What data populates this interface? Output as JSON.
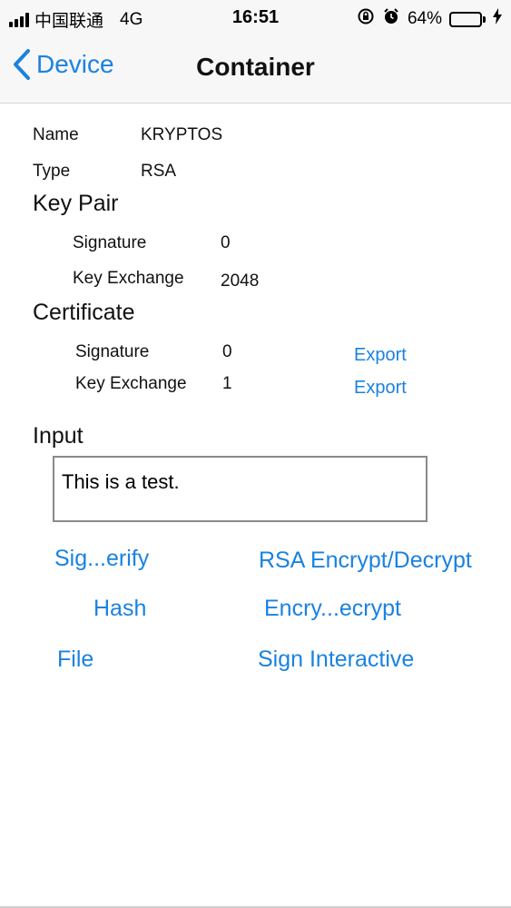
{
  "status_bar": {
    "carrier": "中国联通",
    "network": "4G",
    "time": "16:51",
    "battery_percent": "64%",
    "battery_level": 0.64,
    "icons": [
      "signal-bars-icon",
      "orientation-lock-icon",
      "alarm-icon",
      "battery-icon",
      "charging-icon"
    ]
  },
  "nav": {
    "back_label": "Device",
    "title": "Container"
  },
  "container": {
    "name_label": "Name",
    "name_value": "KRYPTOS",
    "type_label": "Type",
    "type_value": "RSA"
  },
  "key_pair": {
    "header": "Key Pair",
    "signature_label": "Signature",
    "signature_value": "0",
    "key_exchange_label": "Key Exchange",
    "key_exchange_value": "2048"
  },
  "certificate": {
    "header": "Certificate",
    "signature_label": "Signature",
    "signature_value": "0",
    "signature_export": "Export",
    "key_exchange_label": "Key Exchange",
    "key_exchange_value": "1",
    "key_exchange_export": "Export"
  },
  "input": {
    "header": "Input",
    "value": "This is a test."
  },
  "actions": {
    "sign_verify": "Sig...erify",
    "rsa_encrypt_decrypt": "RSA Encrypt/Decrypt",
    "hash": "Hash",
    "encrypt_decrypt": "Encry...ecrypt",
    "file": "File",
    "sign_interactive": "Sign Interactive"
  },
  "colors": {
    "accent": "#1a82e0",
    "battery_fill": "#4cd964",
    "bar_background": "#f7f7f7"
  }
}
